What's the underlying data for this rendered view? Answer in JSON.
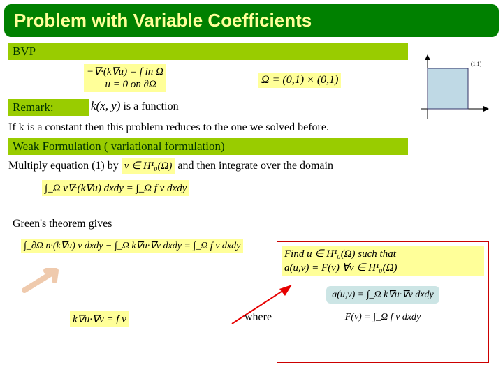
{
  "title": "Problem with Variable Coefficients",
  "sections": {
    "bvp": "BVP",
    "remark": "Remark:",
    "weak": "Weak Formulation ( variational formulation)"
  },
  "equations": {
    "pde_line1": "−∇·(k∇u) = f     in  Ω",
    "pde_line2": "u = 0    on  ∂Ω",
    "domain_def": "Ω = (0,1) × (0,1)",
    "k_xy": "k(x, y)",
    "weak_integral": "∫_Ω v∇·(k∇u) dxdy = ∫_Ω f v dxdy",
    "green_result": "∫_∂Ω n·(k∇u) v dxdy − ∫_Ω k∇u·∇v dxdy = ∫_Ω f v dxdy",
    "final_identity": "k∇u·∇v = f v",
    "find_line1": "Find  u ∈ H¹₀(Ω)   such that",
    "find_line2": "a(u,v) = F(v)    ∀v ∈ H¹₀(Ω)",
    "auv_def": "a(u,v) = ∫_Ω k∇u·∇v dxdy",
    "Fv_def": "F(v) = ∫_Ω f v dxdy",
    "test_fn": "v ∈ H¹₀(Ω)"
  },
  "text": {
    "is_function": " is a function",
    "reduce_note": "If  k is a constant then  this problem reduces to the one we solved before.",
    "multiply_pre": "Multiply equation (1)  by ",
    "multiply_post": " and then integrate over the domain",
    "green_label": "Green's theorem gives",
    "where": "where",
    "corner_label": "(1,1)"
  }
}
